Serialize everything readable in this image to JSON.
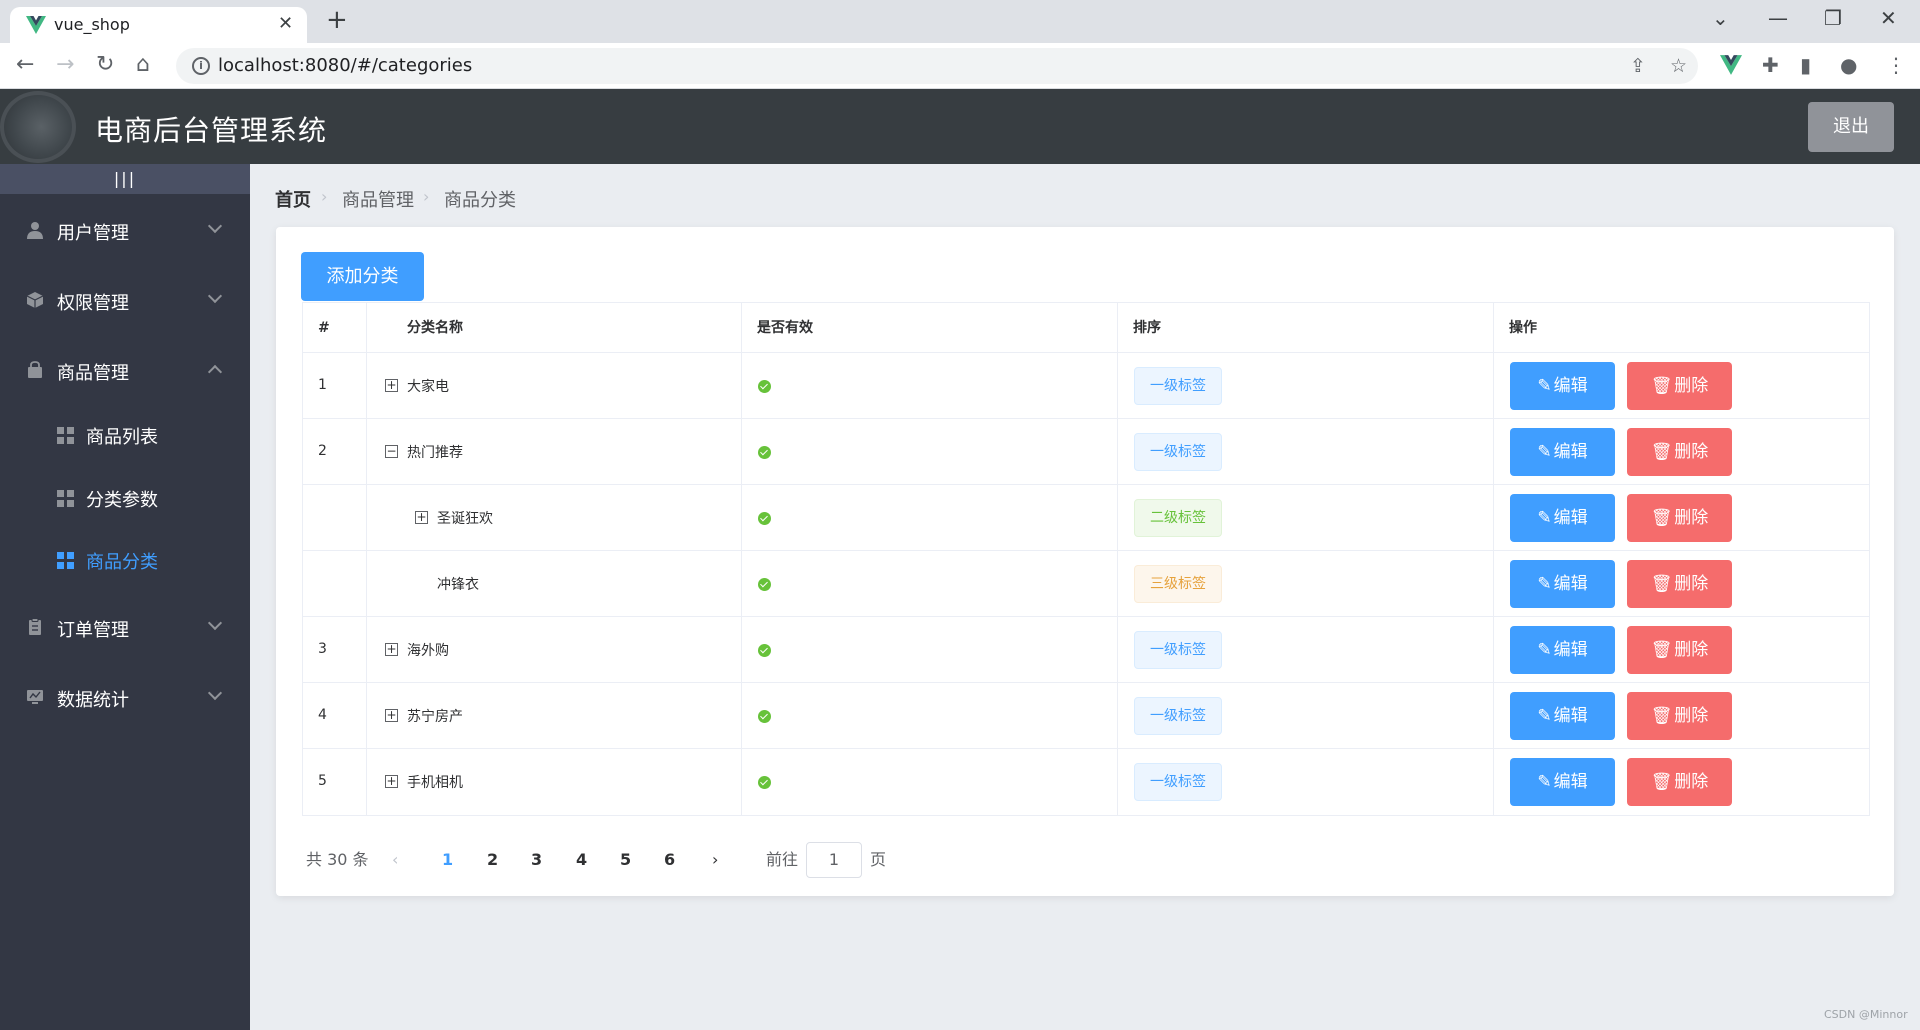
{
  "browser": {
    "tab_title": "vue_shop",
    "url": "localhost:8080/#/categories"
  },
  "app": {
    "title": "电商后台管理系统",
    "logout_label": "退出"
  },
  "sidebar": {
    "collapse_label": "|||",
    "menus": [
      {
        "label": "用户管理",
        "icon": "user-icon",
        "expanded": false
      },
      {
        "label": "权限管理",
        "icon": "cube-icon",
        "expanded": false
      },
      {
        "label": "商品管理",
        "icon": "bag-icon",
        "expanded": true,
        "children": [
          {
            "label": "商品列表",
            "active": false
          },
          {
            "label": "分类参数",
            "active": false
          },
          {
            "label": "商品分类",
            "active": true
          }
        ]
      },
      {
        "label": "订单管理",
        "icon": "clipboard-icon",
        "expanded": false
      },
      {
        "label": "数据统计",
        "icon": "monitor-icon",
        "expanded": false
      }
    ]
  },
  "breadcrumb": [
    "首页",
    "商品管理",
    "商品分类"
  ],
  "add_button_label": "添加分类",
  "table": {
    "headers": [
      "#",
      "分类名称",
      "是否有效",
      "排序",
      "操作"
    ],
    "rows": [
      {
        "index": "1",
        "name": "大家电",
        "level": 1,
        "expand": "+",
        "tag": "一级标签"
      },
      {
        "index": "2",
        "name": "热门推荐",
        "level": 1,
        "expand": "−",
        "tag": "一级标签"
      },
      {
        "index": "",
        "name": "圣诞狂欢",
        "level": 2,
        "expand": "+",
        "tag": "二级标签"
      },
      {
        "index": "",
        "name": "冲锋衣",
        "level": 3,
        "expand": "",
        "tag": "三级标签"
      },
      {
        "index": "3",
        "name": "海外购",
        "level": 1,
        "expand": "+",
        "tag": "一级标签"
      },
      {
        "index": "4",
        "name": "苏宁房产",
        "level": 1,
        "expand": "+",
        "tag": "一级标签"
      },
      {
        "index": "5",
        "name": "手机相机",
        "level": 1,
        "expand": "+",
        "tag": "一级标签"
      }
    ],
    "edit_label": "编辑",
    "delete_label": "删除"
  },
  "pagination": {
    "total_text": "共 30 条",
    "pages": [
      "1",
      "2",
      "3",
      "4",
      "5",
      "6"
    ],
    "current_page": "1",
    "goto_prefix": "前往",
    "goto_value": "1",
    "goto_suffix": "页"
  },
  "watermark": "CSDN @Minnor",
  "colors": {
    "primary": "#409eff",
    "danger": "#f56c6c",
    "success": "#67c23a",
    "warning": "#e6a23c",
    "sidebar_bg": "#333744",
    "header_bg": "#373d41"
  }
}
